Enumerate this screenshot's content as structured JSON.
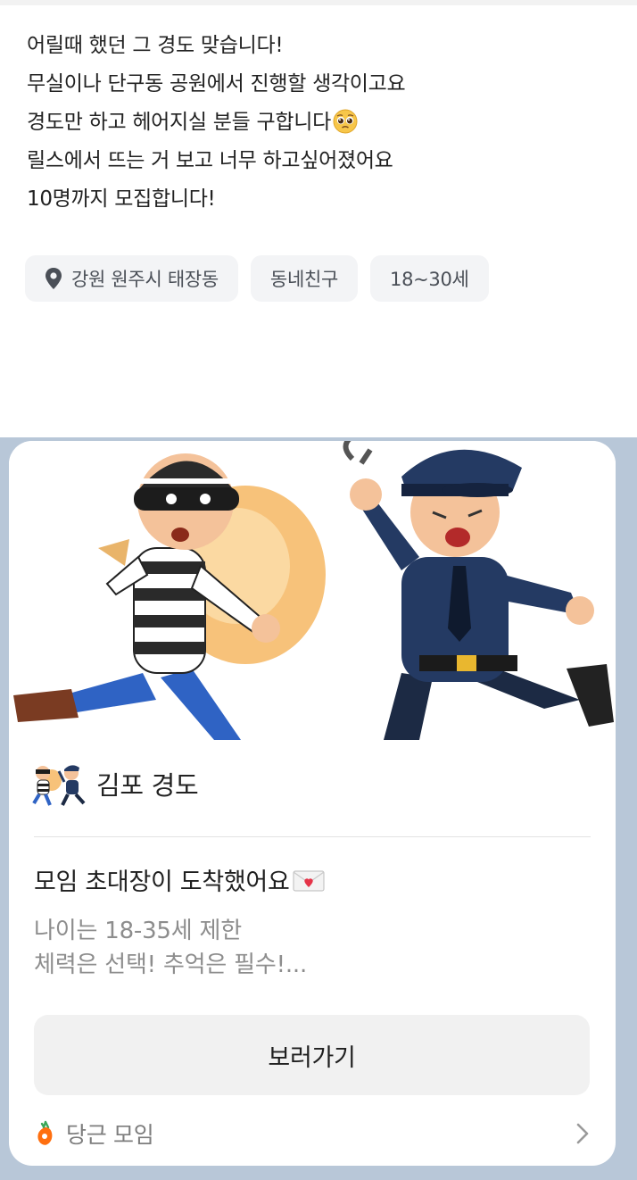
{
  "post": {
    "lines": [
      "어릴때 했던 그 경도 맞습니다!",
      "무실이나 단구동 공원에서 진행할 생각이고요",
      "경도만 하고 헤어지실 분들 구합니다",
      "릴스에서 뜨는 거 보고 너무 하고싶어졌어요",
      "10명까지 모집합니다!"
    ],
    "line3_emoji": "pleading-face-emoji",
    "chips": {
      "location": "강원 원주시 태장동",
      "category": "동네친구",
      "age": "18~30세"
    }
  },
  "card": {
    "image": "thief-and-police-illustration",
    "meeting_name": "김포 경도",
    "invite_title": "모임 초대장이 도착했어요",
    "invite_icon": "love-letter-icon",
    "desc_lines": [
      "나이는 18-35세 제한",
      "체력은 선택! 추억은 필수!..."
    ],
    "button_label": "보러가기",
    "footer_label": "당근 모임",
    "footer_icon": "carrot-icon"
  },
  "colors": {
    "chat_bg": "#b8c7d8",
    "chip_bg": "#f3f4f6",
    "button_bg": "#f1f1f1",
    "accent_carrot": "#ff6f0f"
  }
}
